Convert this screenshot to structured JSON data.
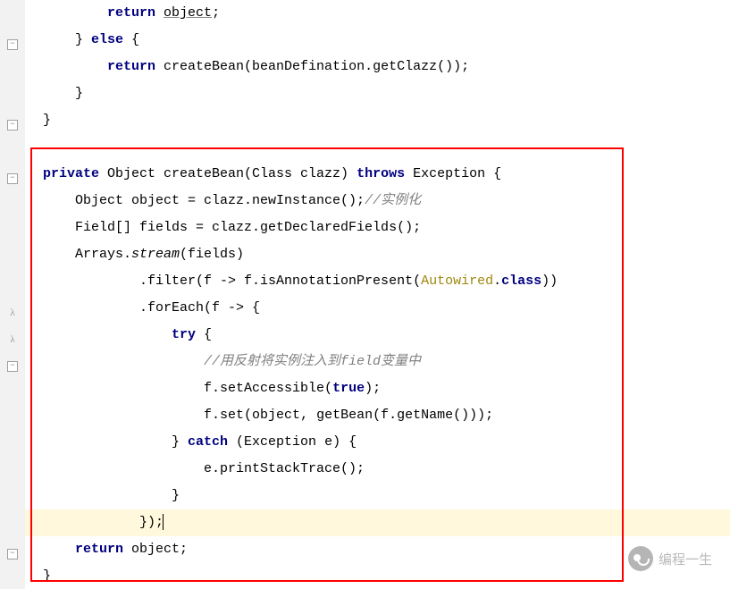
{
  "watermark": "编程一生",
  "code": {
    "l1": "        return object;",
    "l2": "    } else {",
    "l3": "        return createBean(beanDefination.getClazz());",
    "l4": "    }",
    "l5": "}",
    "l6": "",
    "l7": "private Object createBean(Class clazz) throws Exception {",
    "l8a": "    Object object = clazz.newInstance();",
    "l8b": "//实例化",
    "l9": "    Field[] fields = clazz.getDeclaredFields();",
    "l10": "    Arrays.stream(fields)",
    "l11a": "            .filter(f -> f.isAnnotationPresent(",
    "l11b": "Autowired",
    "l11c": ".class))",
    "l12": "            .forEach(f -> {",
    "l13": "                try {",
    "l14": "                    //用反射将实例注入到field变量中",
    "l15a": "                    f.setAccessible(",
    "l15b": "true",
    "l15c": ");",
    "l16a": "                    f.set(",
    "l16b": "object",
    "l16c": ", getBean(f.getName()));",
    "l17": "                } catch (Exception e) {",
    "l18": "                    e.printStackTrace();",
    "l19": "                }",
    "l20": "            });",
    "l21": "    return object;",
    "l22": "}"
  },
  "keywords": {
    "return": "return",
    "else": "else",
    "private": "private",
    "throws": "throws",
    "try": "try",
    "catch": "catch",
    "true": "true",
    "class": "class"
  }
}
